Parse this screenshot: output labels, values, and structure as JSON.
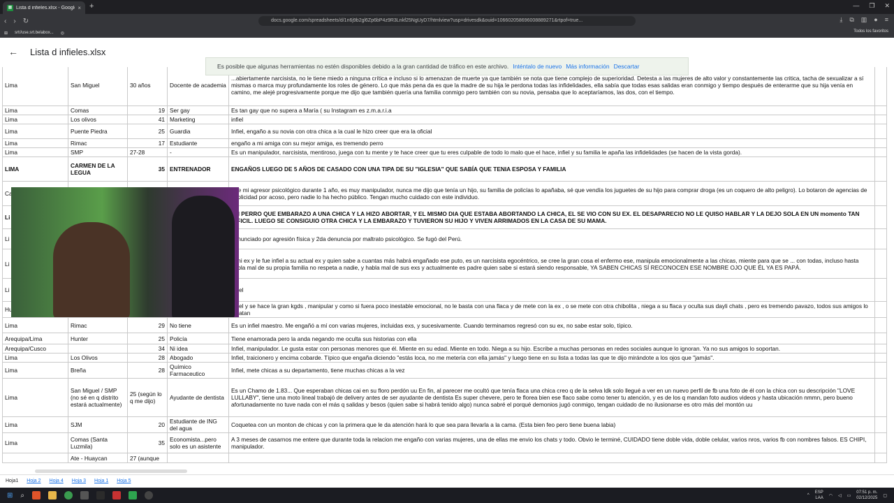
{
  "browser": {
    "tab_title": "Lista d infieles.xlsx - Google Drive",
    "tab_close": "×",
    "new_tab": "+",
    "url": "docs.google.com/spreadsheets/d/1n6j9b2gl6Zp6bP4z9R3Lnkf25NgUyD7/htmlview?usp=drivesdk&ouid=106602058696008889271&rtpof=true...",
    "bookmark_1": "srt//use.srt.belabox...",
    "bookmarks_all": "Todos los favoritos"
  },
  "header": {
    "title": "Lista d infieles.xlsx"
  },
  "toast": {
    "message": "Es posible que algunas herramientas no estén disponibles debido a la gran cantidad de tráfico en este archivo.",
    "retry": "Inténtalo de nuevo",
    "more": "Más información",
    "dismiss": "Descartar"
  },
  "rows": [
    {
      "c1": "Lima",
      "c2": "San Miguel",
      "c3": "30 años",
      "c4": "Docente de academia",
      "c5": "...abiertamente narcisista, no le tiene miedo a ninguna crítica e incluso si lo amenazan de muerte ya que también se nota que tiene complejo de superioridad. Detesta a las mujeres de alto valor y constantemente las critica, tacha de sexualizar a sí mismas o marca muy profundamente los roles de género. Lo que más pena da es que la madre de su hija le perdona todas las infidelidades, ella sabía que todas esas salidas eran conmigo y tiempo después de enterarme que su hija venía en camino, me alejé progresivamente porque me dijo que también quería una familia conmigo pero también con su novia, pensaba que lo aceptaríamos, las dos, con el tiempo.",
      "tall": true
    },
    {
      "c1": "Lima",
      "c2": "Comas",
      "c3": "19",
      "c4": "Ser gay",
      "c5": "Es tan gay que no supera a María ( su Instagram es z.m.a.r.i.a"
    },
    {
      "c1": "Lima",
      "c2": "Los olivos",
      "c3": "41",
      "c4": "Marketing",
      "c5": "infiel"
    },
    {
      "c1": "Lima",
      "c2": "Puente Piedra",
      "c3": "25",
      "c4": "Guardia",
      "c5": "Infiel, engaño a su novia con otra chica a la cual le hizo creer que era la oficial"
    },
    {
      "c1": "Lima",
      "c2": "Rimac",
      "c3": "17",
      "c4": "Estudiante",
      "c5": "engaño a mi amiga con su mejor amiga, es tremendo perro"
    },
    {
      "c1": "Lima",
      "c2": "SMP",
      "c3": "27-28",
      "c4": "-",
      "c5": "Es un manipulador, narcisista, mentiroso, juega con tu mente y te hace creer que tu eres culpable de todo lo malo que el hace, infiel y su familia le apaña las infidelidades (se hacen de la vista gorda)."
    },
    {
      "c1": "LIMA",
      "c2": "CARMEN DE LA LEGUA",
      "c3": "35",
      "c4": "ENTRENADOR",
      "c5": "ENGAÑOS LUEGO DE 5 AÑOS DE CASADO CON UNA TIPA DE SU \"IGLESIA\" QUE SABÍA QUE TENIA ESPOSA Y FAMILIA"
    },
    {
      "c1": "Ca",
      "c2": "",
      "c3": "",
      "c4": "",
      "c5": "Fue mi agresor psicológico durante 1 año, es muy manipulador, nunca me dijo que tenía un hijo, su familia de policías lo apañaba, sé que vendía los juguetes de su hijo para comprar droga (es un coquero de alto peligro). Lo botaron de agencias de publicidad por acoso, pero nadie lo ha hecho público. Tengan mucho cuidado con este individuo."
    },
    {
      "c1": "Li",
      "c2": "",
      "c3": "",
      "c4": "",
      "c5": "UN PERRO QUE EMBARAZO A UNA CHICA Y LA HIZO ABORTAR, Y EL MISMO DIA QUE ESTABA ABORTANDO LA CHICA, EL SE VIO CON SU EX. EL DESAPARECIO NO LE QUISO HABLAR Y LA DEJO SOLA EN UN momento TAN DIFICIL. LUEGO SE CONSIGUIO OTRA CHICA Y LA EMBARAZO Y TUVIERON SU HIJO Y VIVEN ARRIMADOS EN LA CASA DE SU MAMA."
    },
    {
      "c1": "Li",
      "c2": "",
      "c3": "",
      "c4": "",
      "c5": "denunciado por agresión física y 2da denuncia por maltrato psicológico. Se fugó del Perú."
    },
    {
      "c1": "Li",
      "c2": "",
      "c3": "",
      "c4": "",
      "c5": "...mi ex y le fue infiel a su actual ex y quien sabe a cuantas más habrá engañado ese puto, es un narcisista egocéntrico, se cree la gran cosa el enfermo ese, manipula emocionalmente a las chicas, miente para que se ... con todas, incluso hasta habla mal de su propia familia no respeta a nadie, y habla mal de sus exs y actualmente es padre quien sabe si estará siendo responsable, YA SABEN CHICAS SÍ RECONOCEN ESE NOMBRE OJO QUE ÉL YA ES PAPÁ."
    },
    {
      "c1": "Li",
      "c2": "",
      "c3": "",
      "c4": "",
      "c5": "Infiel"
    },
    {
      "c1": "Hu",
      "c2": "",
      "c3": "",
      "c4": "",
      "c5": "Infiel y se hace la gran kgds , manipular y como si fuera poco inestable emocional, no le basta con una flaca y de mete con la ex , o se mete con otra chibolita , niega a su flaca y oculta sus dayli chats , pero es tremendo pavazo, todos sus amigos lo delatan"
    },
    {
      "c1": "Lima",
      "c2": "Rimac",
      "c3": "29",
      "c4": "No tiene",
      "c5": "Es un infiel maestro. Me engañó a mí con varias mujeres, incluidas exs, y sucesivamente. Cuando terminamos regresó con su ex, no sabe estar solo, típico."
    },
    {
      "c1": "Arequipa/Lima",
      "c2": "Hunter",
      "c3": "25",
      "c4": "Policía",
      "c5": "Tiene enamorada pero la anda negando me oculta sus historias con ella"
    },
    {
      "c1": "Arequipa/Cusco",
      "c2": "",
      "c3": "34",
      "c4": "Ni idea",
      "c5": "Infiel, manipulador. Le gusta estar con personas menores que él. Miente en su edad. Miente en todo. Niega a su hijo. Escribe a muchas personas en redes sociales aunque lo ignoran. Ya no sus amigos lo soportan."
    },
    {
      "c1": "Lima",
      "c2": "Los Olivos",
      "c3": "28",
      "c4": "Abogado",
      "c5": "Infiel, traicionero y encima cobarde. Típico que engaña diciendo \"estás loca, no me metería con ella jamás\" y luego tiene en su lista a todas las que te dijo mirándote a los ojos que \"jamás\"."
    },
    {
      "c1": "Lima",
      "c2": "Breña",
      "c3": "28",
      "c4": "Químico Farmaceutico",
      "c5": "Infiel, mete chicas a su departamento, tiene muchas chicas a la vez"
    },
    {
      "c1": "Lima",
      "c2": "San Miguel / SMP (no sé en q distrito estará actualmente)",
      "c3": "25 (según lo q me dijo)",
      "c4": "Ayudante de dentista",
      "c5": "Es un Chamo de 1.83... Que esperaban chicas cai en su floro perdón uu En fin, al parecer me ocultó que tenía flaca una chica creo q de la selva ldk solo llegué a ver en un nuevo perfil de fb una foto de él con la chica con su descripción \"LOVE LULLABY\", tiene una moto lineal trabajó de delivery antes de ser ayudante de dentista Es super chevere, pero te florea bien ese flaco sabe como tener tu atención, y es de los q mandan foto audios videos y hasta ubicación nmmn, pero bueno afortunadamente no tuve nada con el más q salidas y besos (quien sabe si habrá tenido algo) nunca sabré el porqué demonios jugó conmigo, tengan cuidado de no ilusionarse es otro más del montón uu"
    },
    {
      "c1": "Lima",
      "c2": "SJM",
      "c3": "20",
      "c4": "Estudiante de ING del agua",
      "c5": "Coquetea con un monton de chicas y con la primera que le da atención hará lo que sea para llevarla a la cama. (Esta bien feo pero tiene buena labia)"
    },
    {
      "c1": "Lima",
      "c2": "Comas (Santa Luzmila)",
      "c3": "35",
      "c4": "Economista...pero solo es un asistente",
      "c5": "A 3 meses de casarnos me entere que durante toda la relacion me engaño con varias mujeres, una de ellas me envio los chats y todo. Obvio le terminé, CUIDADO tiene doble vida, doble celular, varios nros, varios fb con nombres falsos. ES CHIPI, manipulador."
    },
    {
      "c1": "",
      "c2": "Ate - Huaycan",
      "c3": "27 (aunque",
      "c4": "",
      "c5": ""
    }
  ],
  "sheet_tabs": [
    "Hoja1",
    "Hoja 2",
    "Hoja 4",
    "Hoja 3",
    "Hoja 1",
    "Hoja 5"
  ],
  "taskbar": {
    "lang": "ESP",
    "lang2": "LAA",
    "time": "07:51 p. m.",
    "date": "02/12/2025"
  }
}
